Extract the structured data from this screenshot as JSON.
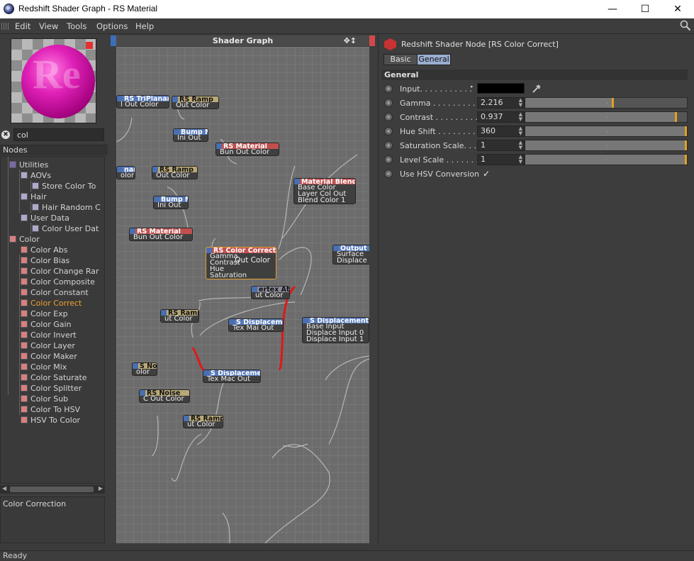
{
  "window": {
    "title": "Redshift Shader Graph - RS Material",
    "minimize": "—",
    "maximize": "☐",
    "close": "✕"
  },
  "menu": [
    "Edit",
    "View",
    "Tools",
    "Options",
    "Help"
  ],
  "search": {
    "value": "col",
    "clear_icon": "✖"
  },
  "nodes_header": "Nodes",
  "tree": [
    {
      "label": "Utilities",
      "level": 0,
      "color": "#7a6aa8"
    },
    {
      "label": "AOVs",
      "level": 1,
      "color": "#b0a8cc"
    },
    {
      "label": "Store Color To",
      "level": 2,
      "color": "#b0a8cc"
    },
    {
      "label": "Hair",
      "level": 1,
      "color": "#b0a8cc"
    },
    {
      "label": "Hair Random C",
      "level": 2,
      "color": "#b0a8cc"
    },
    {
      "label": "User Data",
      "level": 1,
      "color": "#b0a8cc"
    },
    {
      "label": "Color User Dat",
      "level": 2,
      "color": "#b0a8cc"
    },
    {
      "label": "Color",
      "level": 0,
      "color": "#d88080"
    },
    {
      "label": "Color Abs",
      "level": 1,
      "color": "#d88080"
    },
    {
      "label": "Color Bias",
      "level": 1,
      "color": "#d88080"
    },
    {
      "label": "Color Change Rar",
      "level": 1,
      "color": "#d88080"
    },
    {
      "label": "Color Composite",
      "level": 1,
      "color": "#d88080"
    },
    {
      "label": "Color Constant",
      "level": 1,
      "color": "#d88080"
    },
    {
      "label": "Color Correct",
      "level": 1,
      "color": "#d88080",
      "selected": true
    },
    {
      "label": "Color Exp",
      "level": 1,
      "color": "#d88080"
    },
    {
      "label": "Color Gain",
      "level": 1,
      "color": "#d88080"
    },
    {
      "label": "Color Invert",
      "level": 1,
      "color": "#d88080"
    },
    {
      "label": "Color Layer",
      "level": 1,
      "color": "#d88080"
    },
    {
      "label": "Color Maker",
      "level": 1,
      "color": "#d88080"
    },
    {
      "label": "Color Mix",
      "level": 1,
      "color": "#d88080"
    },
    {
      "label": "Color Saturate",
      "level": 1,
      "color": "#d88080"
    },
    {
      "label": "Color Splitter",
      "level": 1,
      "color": "#d88080"
    },
    {
      "label": "Color Sub",
      "level": 1,
      "color": "#d88080"
    },
    {
      "label": "Color To HSV",
      "level": 1,
      "color": "#d88080"
    },
    {
      "label": "HSV To Color",
      "level": 1,
      "color": "#d88080"
    }
  ],
  "description": "Color Correction",
  "graph": {
    "title": "Shader Graph",
    "nodes": [
      {
        "id": "triplanar",
        "header": "RS TriPlanar",
        "body": [
          "l Out Color"
        ],
        "style": "blue"
      },
      {
        "id": "ramp1",
        "header": "RS Ramp",
        "body": [
          "Out Color"
        ],
        "style": "tan"
      },
      {
        "id": "bump1",
        "header": "Bump M",
        "body": [
          "Ini Out"
        ],
        "style": "blue"
      },
      {
        "id": "mat1",
        "header": "RS Material",
        "body": [
          "Bun Out Color"
        ],
        "style": "red"
      },
      {
        "id": "nar",
        "header": "nar",
        "body": [
          "olor"
        ],
        "style": "blue"
      },
      {
        "id": "ramp2",
        "header": "RS Ramp",
        "body": [
          "Out Color"
        ],
        "style": "tan"
      },
      {
        "id": "bump2",
        "header": "Bump M",
        "body": [
          "Ini Out"
        ],
        "style": "blue"
      },
      {
        "id": "mat2",
        "header": "RS Material",
        "body": [
          "Bun Out Color"
        ],
        "style": "red"
      },
      {
        "id": "blender",
        "header": "Material Blend",
        "body": [
          "Base Color",
          "Layer Col Out",
          "Blend Color 1"
        ],
        "style": "red"
      },
      {
        "id": "cc",
        "header": "RS Color Correct",
        "body": [
          "Gamma",
          "Contrast",
          "Hue",
          "Saturation"
        ],
        "out": "Out Color",
        "style": "red"
      },
      {
        "id": "output",
        "header": "Output",
        "body": [
          "Surface",
          "Displace"
        ],
        "style": "blue"
      },
      {
        "id": "vattr",
        "header": "ertex Attr",
        "body": [
          "ut Color"
        ],
        "style": "gray"
      },
      {
        "id": "ramp3",
        "header": "RS Ramp",
        "body": [
          "ut Color"
        ],
        "style": "tan"
      },
      {
        "id": "disp1",
        "header": "S Displacemer",
        "body": [
          "Tex Mai Out"
        ],
        "style": "blue"
      },
      {
        "id": "dispbl",
        "header": "S Displacement Bl",
        "body": [
          "Base Input",
          "Displace Input 0",
          "Displace Input 1"
        ],
        "style": "blue"
      },
      {
        "id": "noi",
        "header": "S Noi",
        "body": [
          "olor"
        ],
        "style": "tan"
      },
      {
        "id": "disp2",
        "header": "S Displacemer",
        "body": [
          "Tex Mac Out"
        ],
        "style": "blue"
      },
      {
        "id": "noise",
        "header": "RS Noise",
        "body": [
          "C Out Color"
        ],
        "style": "tan"
      },
      {
        "id": "ramp4",
        "header": "RS Ramp",
        "body": [
          "ut Color"
        ],
        "style": "tan"
      }
    ]
  },
  "attributes": {
    "node_title": "Redshift Shader Node [RS Color Correct]",
    "tabs": [
      {
        "label": "Basic",
        "active": false
      },
      {
        "label": "General",
        "active": true
      }
    ],
    "section": "General",
    "params": [
      {
        "label": "Input. . . . . . . . . . .",
        "type": "color",
        "value": "#000000",
        "picker_icon": "eyedropper-icon"
      },
      {
        "label": "Gamma . . . . . . . . . . .",
        "type": "slider",
        "value": "2.216",
        "fraction": 0.55
      },
      {
        "label": "Contrast . . . . . . . . . .",
        "type": "slider",
        "value": "0.937",
        "fraction": 0.94
      },
      {
        "label": "Hue Shift . . . . . . . . .",
        "type": "slider",
        "value": "360",
        "fraction": 1.0
      },
      {
        "label": "Saturation Scale. . . . .",
        "type": "slider",
        "value": "1",
        "fraction": 1.0
      },
      {
        "label": "Level Scale . . . . . . . .",
        "type": "slider",
        "value": "1",
        "fraction": 1.0
      },
      {
        "label": "Use HSV Conversion",
        "type": "check",
        "value": "✓"
      }
    ]
  },
  "status": "Ready"
}
